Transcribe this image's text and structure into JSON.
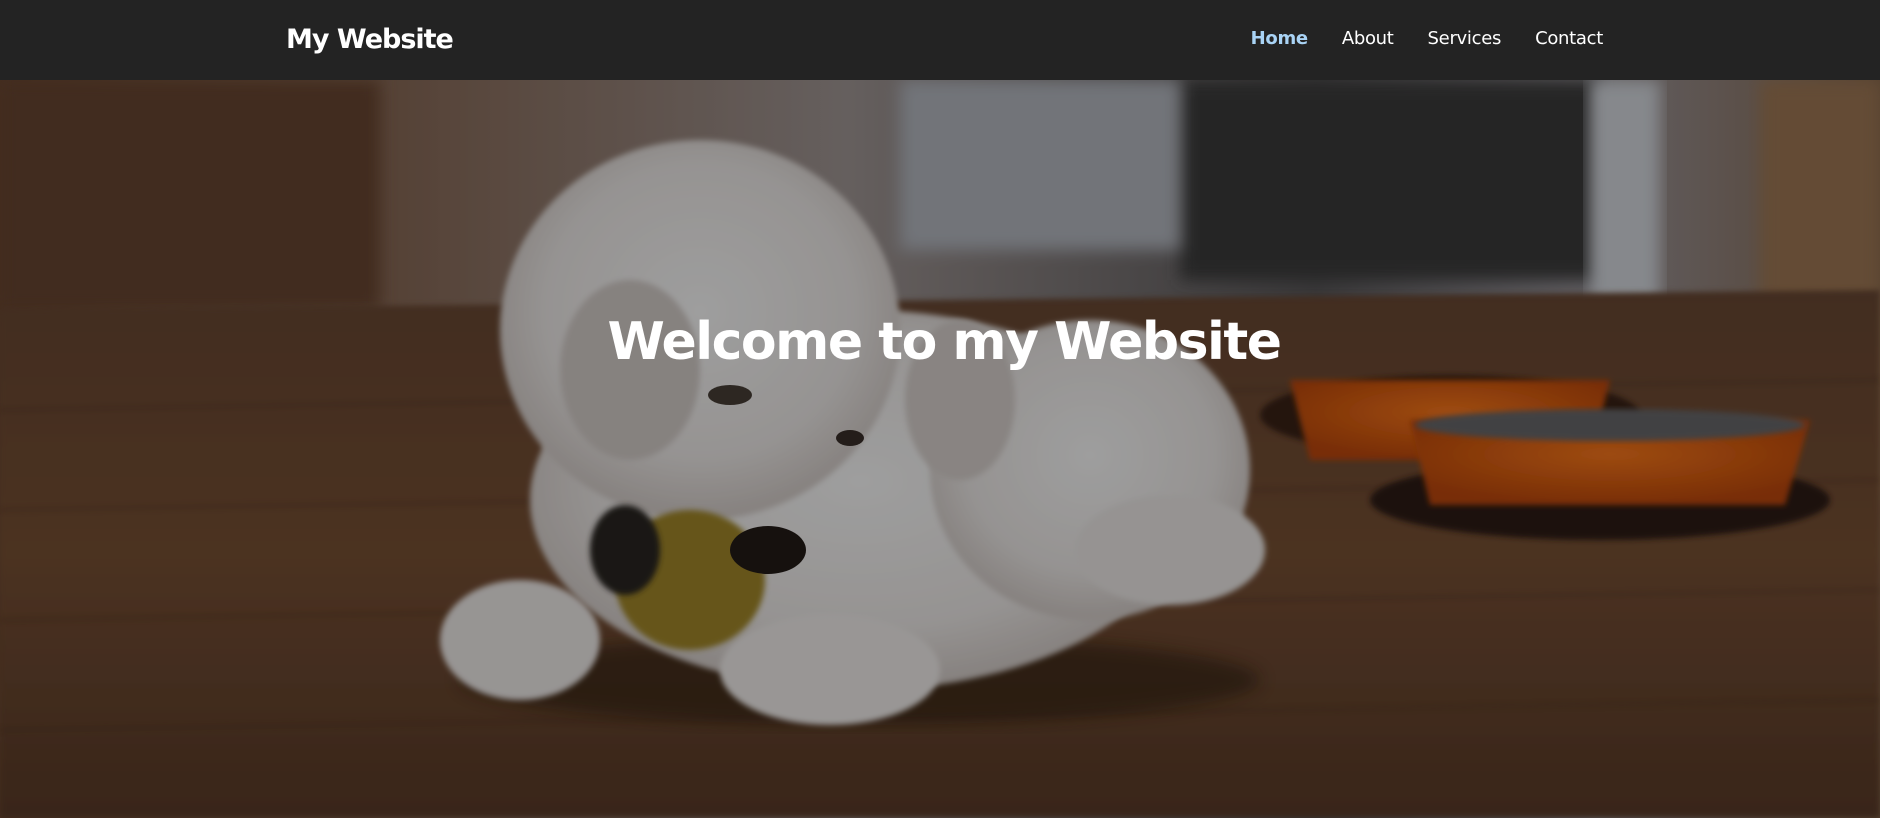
{
  "header": {
    "brand": "My Website",
    "nav": [
      {
        "label": "Home",
        "active": true
      },
      {
        "label": "About",
        "active": false
      },
      {
        "label": "Services",
        "active": false
      },
      {
        "label": "Contact",
        "active": false
      }
    ]
  },
  "hero": {
    "title": "Welcome to my Website"
  },
  "colors": {
    "navbar_bg": "#232323",
    "nav_active": "#a9d3f5",
    "text": "#ffffff"
  }
}
